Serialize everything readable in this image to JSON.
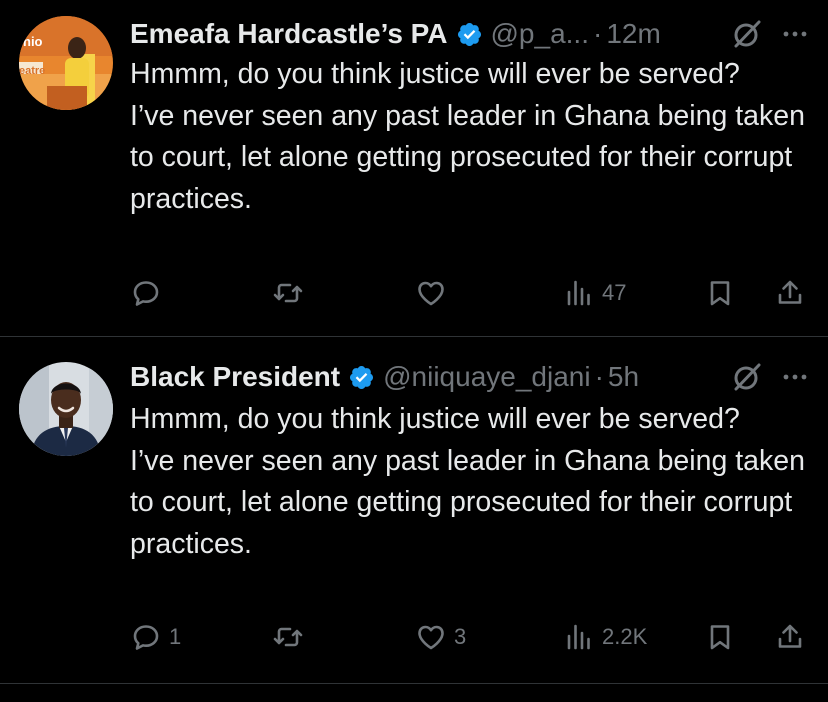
{
  "tweets": [
    {
      "display_name": "Emeafa Hardcastle’s PA",
      "handle": "@p_a...",
      "separator": "·",
      "time": "12m",
      "text_lines": [
        "Hmmm, do you think justice will ever be served?",
        "I’ve never seen any past leader in Ghana being taken to court, let alone getting prosecuted for their corrupt practices."
      ],
      "avatar_partial_text": [
        "nio",
        "eatre"
      ],
      "actions": {
        "reply_count": "",
        "retweet_count": "",
        "like_count": "",
        "views_count": "47"
      }
    },
    {
      "display_name": "Black President",
      "handle": "@niiquaye_djani",
      "separator": "·",
      "time": "5h",
      "text_lines": [
        "Hmmm, do you think justice will ever be served?",
        "I’ve never seen any past leader in Ghana being taken to court, let alone getting prosecuted for their corrupt practices."
      ],
      "actions": {
        "reply_count": "1",
        "retweet_count": "",
        "like_count": "3",
        "views_count": "2.2K"
      }
    }
  ],
  "icons": {
    "verified": "verified-badge-icon",
    "grok": "grok-icon",
    "more": "more-icon",
    "reply": "reply-icon",
    "retweet": "retweet-icon",
    "like": "like-icon",
    "views": "views-icon",
    "bookmark": "bookmark-icon",
    "share": "share-icon"
  },
  "colors": {
    "background": "#000000",
    "text_primary": "#e7e9ea",
    "text_secondary": "#71767b",
    "verified": "#1d9bf0",
    "divider": "#2f3336"
  }
}
